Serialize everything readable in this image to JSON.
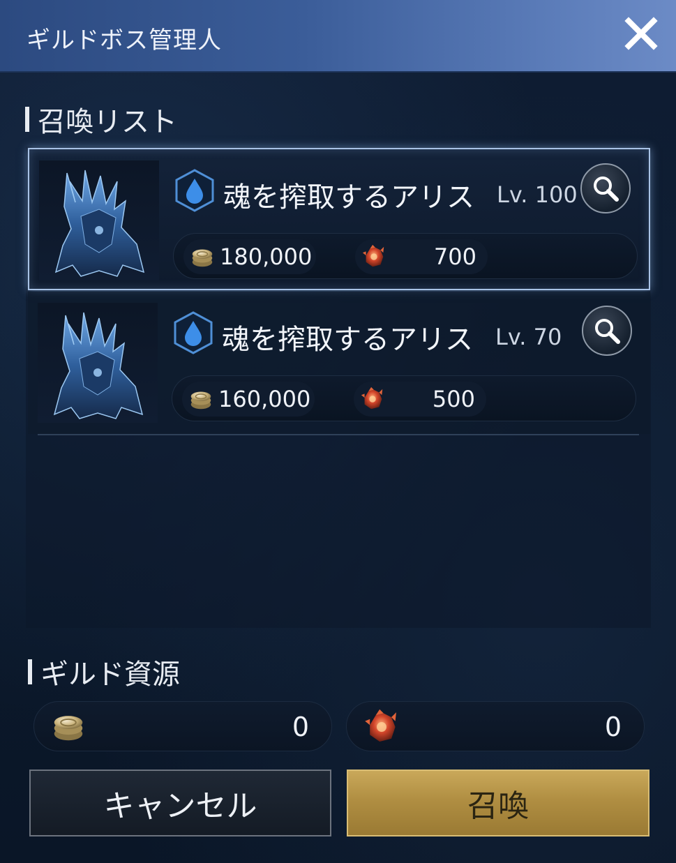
{
  "header": {
    "title": "ギルドボス管理人",
    "close_icon": "close-icon"
  },
  "summon_list": {
    "heading": "召喚リスト",
    "items": [
      {
        "name": "魂を搾取するアリス",
        "level": "Lv. 100",
        "element_icon": "water-drop-icon",
        "gold_cost": "180,000",
        "material_cost": "700",
        "selected": true
      },
      {
        "name": "魂を搾取するアリス",
        "level": "Lv. 70",
        "element_icon": "water-drop-icon",
        "gold_cost": "160,000",
        "material_cost": "500",
        "selected": false
      }
    ]
  },
  "guild_resources": {
    "heading": "ギルド資源",
    "gold": "0",
    "material": "0"
  },
  "buttons": {
    "cancel": "キャンセル",
    "summon": "召喚"
  },
  "colors": {
    "header_gradient_start": "#2c4a80",
    "header_gradient_end": "#6c8bc6",
    "summon_button": "#b08e42",
    "selected_border": "#a9c3e6",
    "background": "#0c1a2d"
  }
}
